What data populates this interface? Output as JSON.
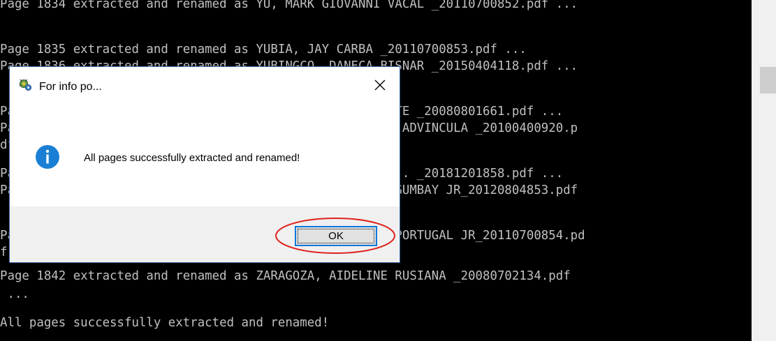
{
  "console": {
    "lines": [
      "Page 1834 extracted and renamed as YU, MARK GIOVANNI VACAL _20110700852.pdf ...",
      "",
      "Page 1835 extracted and renamed as YUBIA, JAY CARBA _20110700853.pdf ...",
      "Page 1836 extracted and renamed as YUBINGCO, DANECA BISNAR _20150404118.pdf ...",
      "",
      "Page 1837 extracted and renamed as YUMOLO, HYDIE REPONTE _20080801661.pdf ...",
      "Page 1838 extracted and renamed as ZAPATA, GREG KALVIN ADVINCULA _20100400920.p",
      "df ...",
      "Page 1839 extracted and renamed as ZARAGOSAS, ALBERTO .. _20181201858.pdf ...",
      "Page 1840 extracted and renamed as ZARAGOSAS, ROBERT AGUMBAY JR_20120804853.pdf",
      " ...",
      "Page 1841 extracted and renamed as ZARAGOZA, DIOSCORO PORTUGAL JR_20110700854.pd",
      "f ...",
      "Page 1842 extracted and renamed as ZARAGOZA, AIDELINE RUSIANA _20080702134.pdf",
      " ...",
      "All pages successfully extracted and renamed!"
    ]
  },
  "dialog": {
    "title": "For info po...",
    "message": "All pages successfully extracted and renamed!",
    "ok_label": "OK",
    "app_icon": "app-icon",
    "info_icon": "info-icon",
    "close_icon": "close-icon"
  },
  "colors": {
    "console_bg": "#000000",
    "console_text": "#c0c0c0",
    "info_blue": "#1a7fd4",
    "highlight_red": "#e0201b",
    "button_focus": "#0078d7"
  }
}
